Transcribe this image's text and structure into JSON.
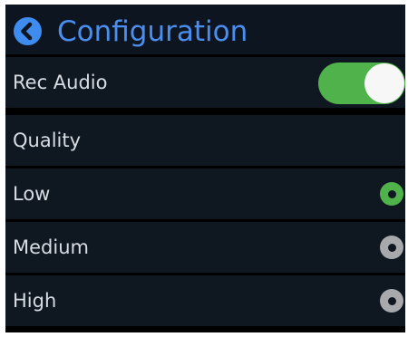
{
  "header": {
    "title": "Configuration",
    "back_icon": "chevron-left-icon",
    "accent_color": "#4b8ef0"
  },
  "settings": {
    "rec_audio": {
      "label": "Rec Audio",
      "enabled": true,
      "toggle_color": "#4fb24a"
    },
    "quality": {
      "label": "Quality",
      "options": [
        {
          "label": "Low",
          "selected": true
        },
        {
          "label": "Medium",
          "selected": false
        },
        {
          "label": "High",
          "selected": false
        }
      ]
    }
  }
}
